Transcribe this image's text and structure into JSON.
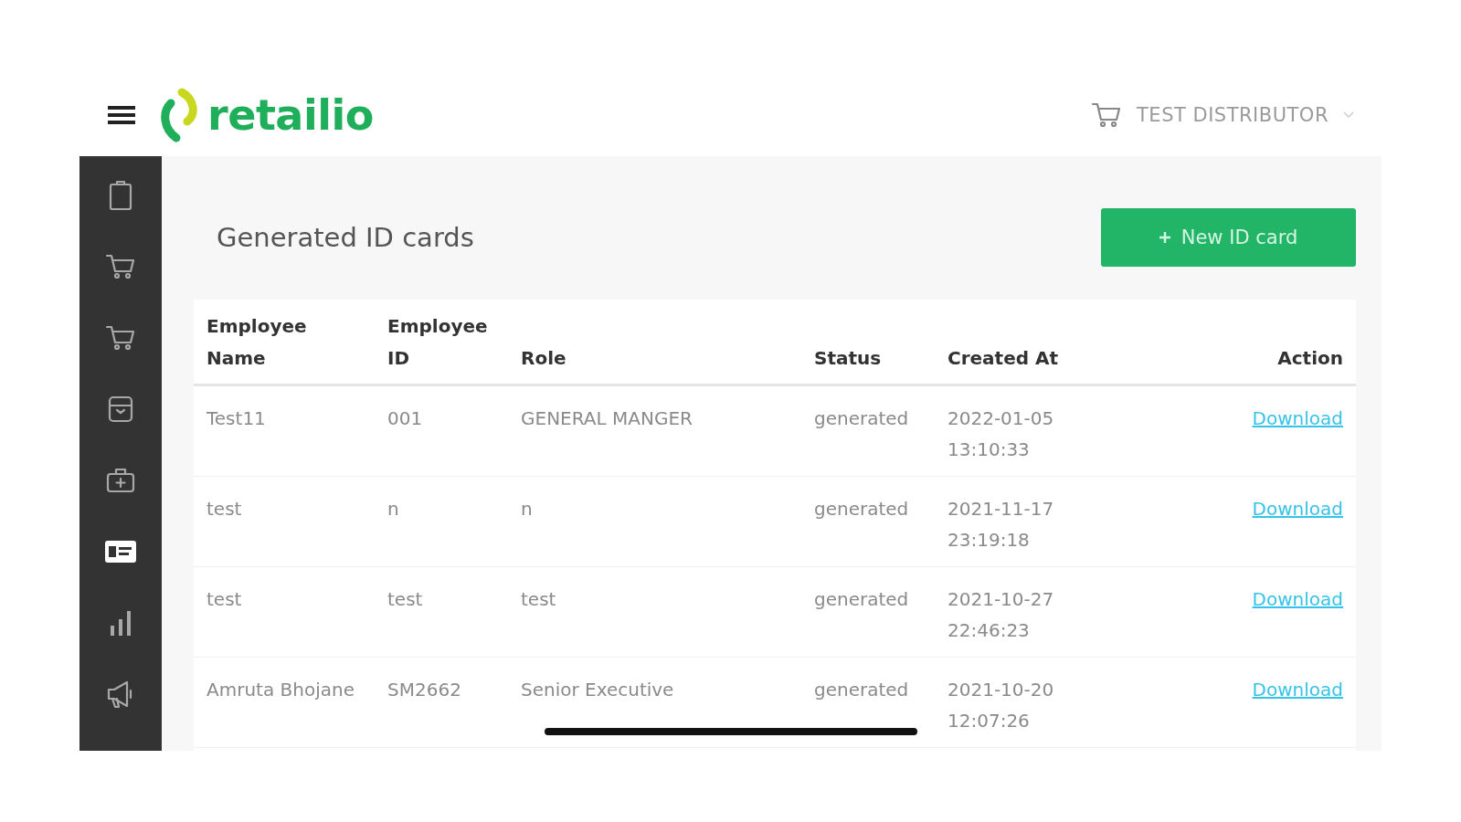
{
  "header": {
    "logo": "retailio",
    "account": "TEST DISTRIBUTOR"
  },
  "sidebar": {
    "items": [
      {
        "selected": false
      },
      {
        "selected": false
      },
      {
        "selected": false
      },
      {
        "selected": false
      },
      {
        "selected": false
      },
      {
        "selected": true
      },
      {
        "selected": false
      },
      {
        "selected": false
      }
    ]
  },
  "page": {
    "title": "Generated ID cards",
    "new_button": "New ID card"
  },
  "table": {
    "columns": [
      "Employee Name",
      "Employee ID",
      "Role",
      "Status",
      "Created At",
      "Action"
    ],
    "rows": [
      {
        "cells": [
          "Test11",
          "001",
          "GENERAL MANGER",
          "generated",
          "2022-01-05 13:10:33"
        ],
        "action": "Download"
      },
      {
        "cells": [
          "test",
          "n",
          "n",
          "generated",
          "2021-11-17 23:19:18"
        ],
        "action": "Download"
      },
      {
        "cells": [
          "test",
          "test",
          "test",
          "generated",
          "2021-10-27 22:46:23"
        ],
        "action": "Download"
      },
      {
        "cells": [
          "Amruta Bhojane",
          "SM2662",
          "Senior Executive",
          "generated",
          "2021-10-20 12:07:26"
        ],
        "action": "Download"
      }
    ]
  }
}
